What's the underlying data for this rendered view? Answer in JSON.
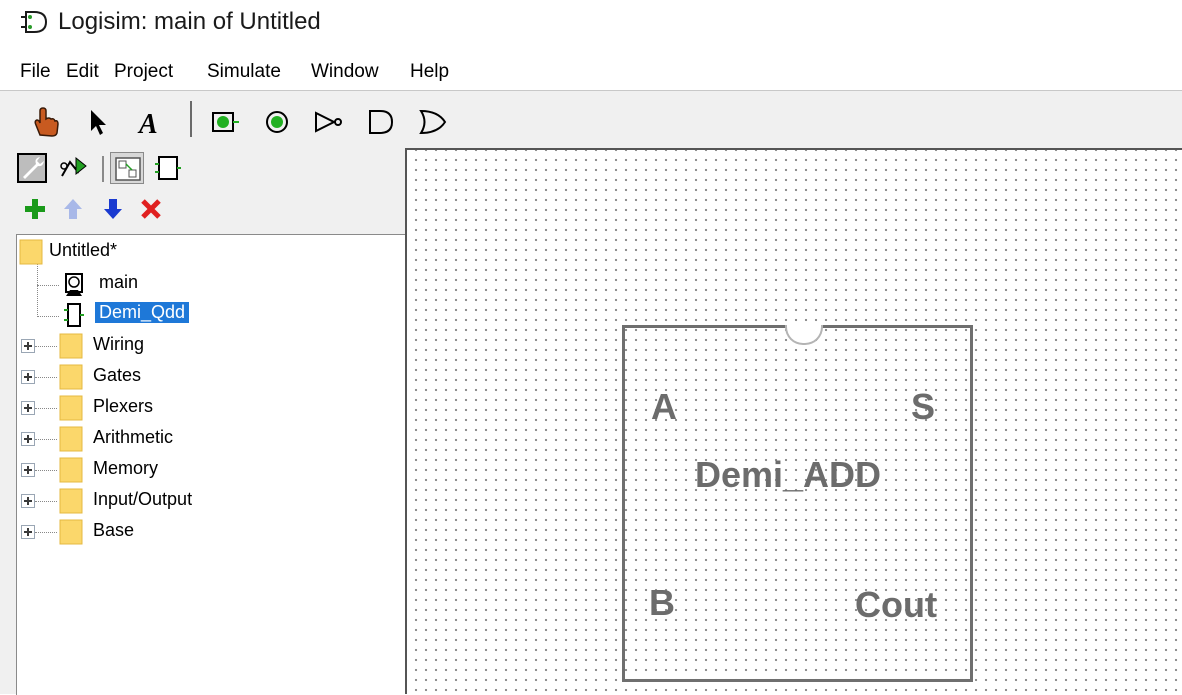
{
  "window": {
    "title": "Logisim: main of Untitled"
  },
  "menu": [
    "File",
    "Edit",
    "Project",
    "Simulate",
    "Window",
    "Help"
  ],
  "toolbar": {
    "tools": [
      "hand-poke-icon",
      "select-arrow-icon",
      "text-tool-icon",
      "input-pin-icon",
      "output-pin-icon",
      "not-gate-icon",
      "and-gate-icon",
      "or-gate-icon"
    ],
    "text_tool_glyph": "A"
  },
  "explorer": {
    "toolbar": [
      "properties-icon",
      "simulation-tree-icon",
      "layout-view-icon",
      "appearance-view-icon"
    ],
    "controls": [
      "add-circuit-icon",
      "move-up-icon",
      "move-down-icon",
      "delete-icon"
    ],
    "project": "Untitled*",
    "circuits": [
      "main",
      "Demi_Qdd"
    ],
    "selected": "Demi_Qdd",
    "libraries": [
      "Wiring",
      "Gates",
      "Plexers",
      "Arithmetic",
      "Memory",
      "Input/Output",
      "Base"
    ]
  },
  "canvas": {
    "component": {
      "name": "Demi_ADD",
      "pins": {
        "a": "A",
        "b": "B",
        "s": "S",
        "cout": "Cout"
      }
    }
  },
  "colors": {
    "selection": "#1e78d8",
    "folder": "#fbd76b",
    "component_stroke": "#6f6f6f"
  }
}
